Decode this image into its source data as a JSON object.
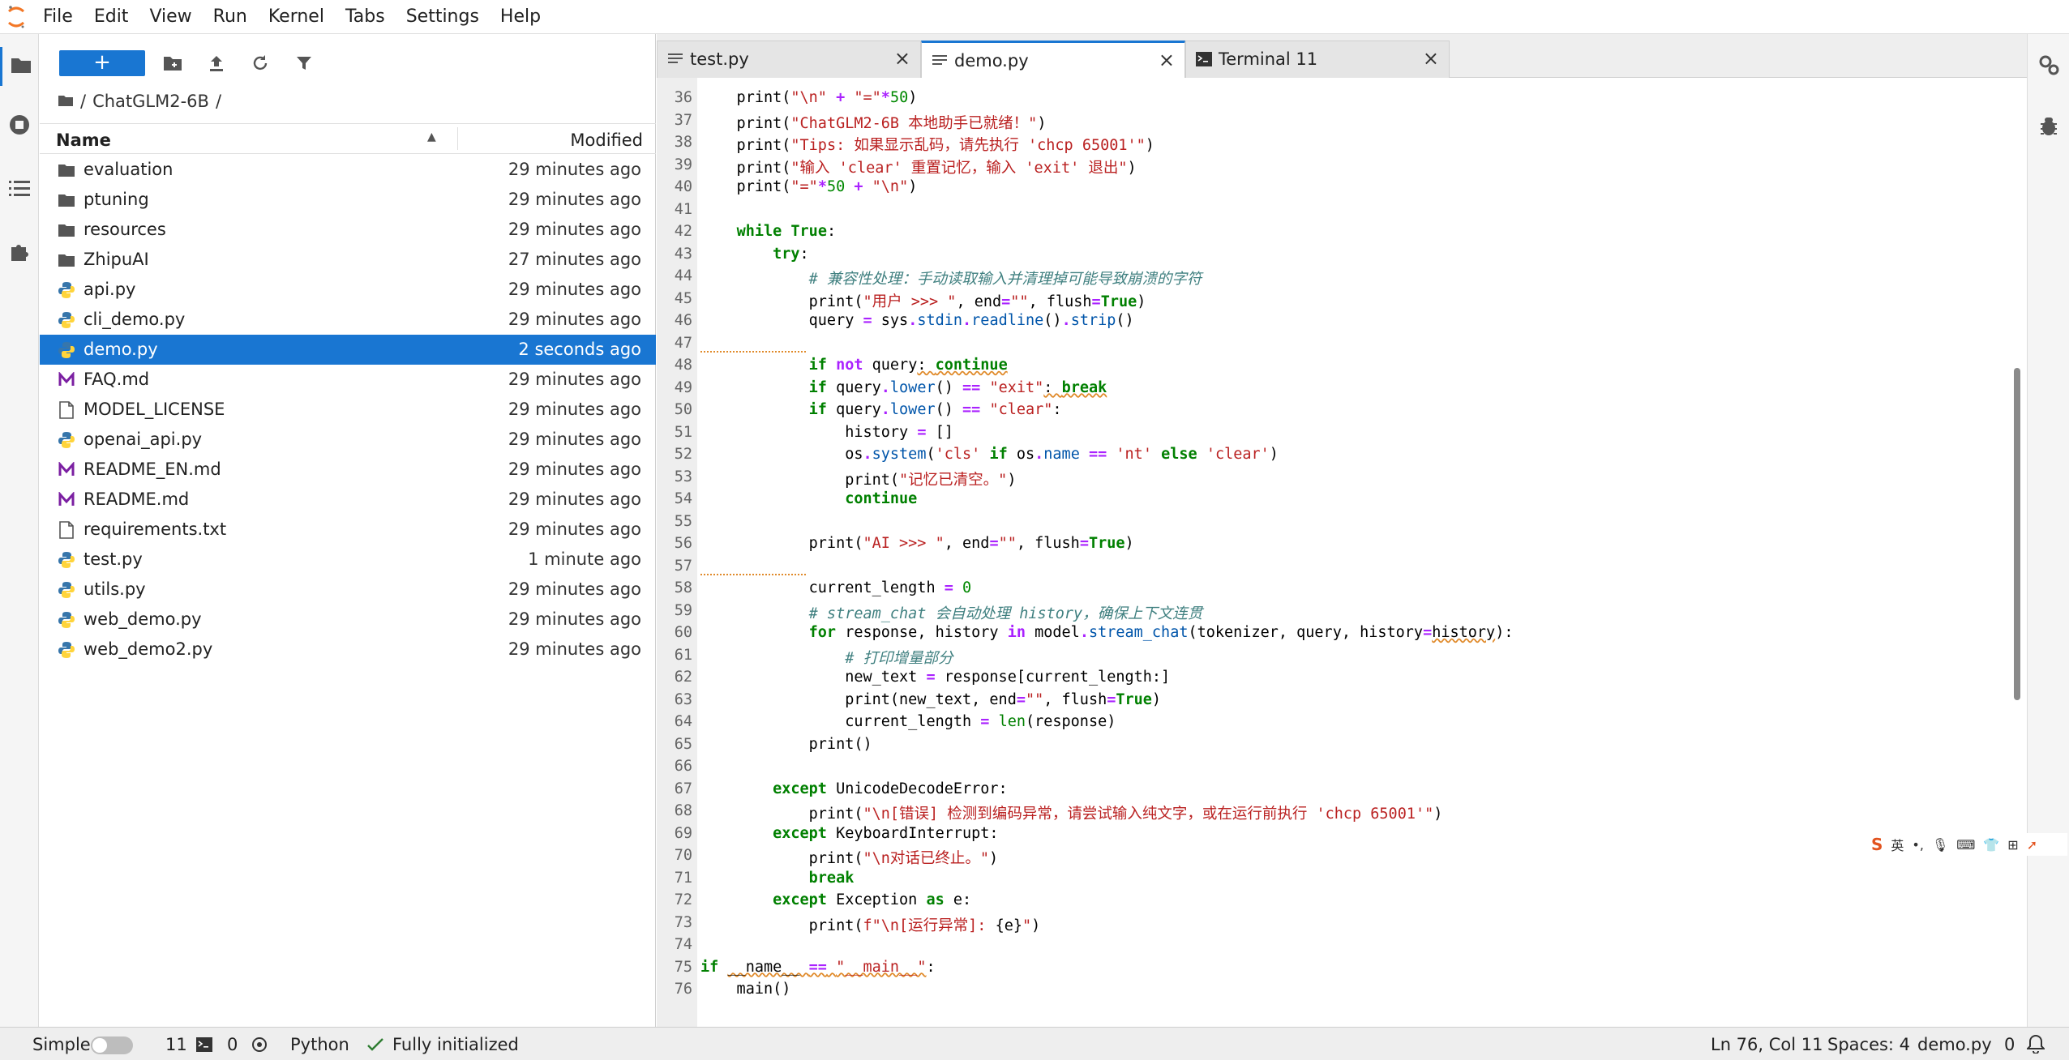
{
  "menubar": {
    "items": [
      "File",
      "Edit",
      "View",
      "Run",
      "Kernel",
      "Tabs",
      "Settings",
      "Help"
    ]
  },
  "filebrowser": {
    "new_label": "+",
    "breadcrumb": [
      "/",
      "ChatGLM2-6B",
      "/"
    ],
    "col_name": "Name",
    "col_modified": "Modified",
    "files": [
      {
        "name": "evaluation",
        "modified": "29 minutes ago",
        "icon": "folder-icon"
      },
      {
        "name": "ptuning",
        "modified": "29 minutes ago",
        "icon": "folder-icon"
      },
      {
        "name": "resources",
        "modified": "29 minutes ago",
        "icon": "folder-icon"
      },
      {
        "name": "ZhipuAI",
        "modified": "27 minutes ago",
        "icon": "folder-icon"
      },
      {
        "name": "api.py",
        "modified": "29 minutes ago",
        "icon": "python-file-icon"
      },
      {
        "name": "cli_demo.py",
        "modified": "29 minutes ago",
        "icon": "python-file-icon"
      },
      {
        "name": "demo.py",
        "modified": "2 seconds ago",
        "icon": "python-file-icon",
        "selected": true
      },
      {
        "name": "FAQ.md",
        "modified": "29 minutes ago",
        "icon": "markdown-file-icon"
      },
      {
        "name": "MODEL_LICENSE",
        "modified": "29 minutes ago",
        "icon": "text-file-icon"
      },
      {
        "name": "openai_api.py",
        "modified": "29 minutes ago",
        "icon": "python-file-icon"
      },
      {
        "name": "README_EN.md",
        "modified": "29 minutes ago",
        "icon": "markdown-file-icon"
      },
      {
        "name": "README.md",
        "modified": "29 minutes ago",
        "icon": "markdown-file-icon"
      },
      {
        "name": "requirements.txt",
        "modified": "29 minutes ago",
        "icon": "text-file-icon"
      },
      {
        "name": "test.py",
        "modified": "1 minute ago",
        "icon": "python-file-icon"
      },
      {
        "name": "utils.py",
        "modified": "29 minutes ago",
        "icon": "python-file-icon"
      },
      {
        "name": "web_demo.py",
        "modified": "29 minutes ago",
        "icon": "python-file-icon"
      },
      {
        "name": "web_demo2.py",
        "modified": "29 minutes ago",
        "icon": "python-file-icon"
      }
    ]
  },
  "tabs": [
    {
      "label": "test.py",
      "icon": "text-editor-icon",
      "active": false,
      "close": "×"
    },
    {
      "label": "demo.py",
      "icon": "text-editor-icon",
      "active": true,
      "close": "×"
    },
    {
      "label": "Terminal 11",
      "icon": "terminal-icon",
      "active": false,
      "close": "×"
    }
  ],
  "add_tab": "+",
  "editor": {
    "lines": [
      {
        "n": "36",
        "html": "    print(<span class='str'>\"\\n\"</span> <span class='op'>+</span> <span class='str'>\"=\"</span><span class='op'>*</span><span class='num'>50</span>)"
      },
      {
        "n": "37",
        "html": "    print(<span class='str'>\"ChatGLM2-6B 本地助手已就绪！\"</span>)"
      },
      {
        "n": "38",
        "html": "    print(<span class='str'>\"Tips: 如果显示乱码，请先执行 'chcp 65001'\"</span>)"
      },
      {
        "n": "39",
        "html": "    print(<span class='str'>\"输入 'clear' 重置记忆，输入 'exit' 退出\"</span>)"
      },
      {
        "n": "40",
        "html": "    print(<span class='str'>\"=\"</span><span class='op'>*</span><span class='num'>50</span> <span class='op'>+</span> <span class='str'>\"\\n\"</span>)"
      },
      {
        "n": "41",
        "html": ""
      },
      {
        "n": "42",
        "html": "    <span class='kw'>while</span> <span class='kw'>True</span>:"
      },
      {
        "n": "43",
        "html": "        <span class='kw'>try</span>:"
      },
      {
        "n": "44",
        "html": "            <span class='cm'># 兼容性处理：手动读取输入并清理掉可能导致崩溃的字符</span>"
      },
      {
        "n": "45",
        "html": "            print(<span class='str'>\"用户 >>> \"</span>, end<span class='op'>=</span><span class='str'>\"\"</span>, flush<span class='op'>=</span><span class='kw'>True</span>)"
      },
      {
        "n": "46",
        "html": "            query <span class='op'>=</span> sys<span class='op'>.</span><span class='attr'>stdin</span><span class='op'>.</span><span class='attr'>readline</span>()<span class='op'>.</span><span class='attr'>strip</span>()"
      },
      {
        "n": "47",
        "html": "",
        "squiggle": true
      },
      {
        "n": "48",
        "html": "            <span class='kw'>if</span> <span class='op'>not</span> query<span class='squiggle'>: <span class='kw'>continue</span></span>"
      },
      {
        "n": "49",
        "html": "            <span class='kw'>if</span> query<span class='op'>.</span><span class='attr'>lower</span>() <span class='op'>==</span> <span class='str'>\"exit\"</span><span class='squiggle'>: <span class='kw'>break</span></span>"
      },
      {
        "n": "50",
        "html": "            <span class='kw'>if</span> query<span class='op'>.</span><span class='attr'>lower</span>() <span class='op'>==</span> <span class='str'>\"clear\"</span>:"
      },
      {
        "n": "51",
        "html": "                history <span class='op'>=</span> []"
      },
      {
        "n": "52",
        "html": "                os<span class='op'>.</span><span class='attr'>system</span>(<span class='str'>'cls'</span> <span class='kw'>if</span> os<span class='op'>.</span><span class='attr'>name</span> <span class='op'>==</span> <span class='str'>'nt'</span> <span class='kw'>else</span> <span class='str'>'clear'</span>)"
      },
      {
        "n": "53",
        "html": "                print(<span class='str'>\"记忆已清空。\"</span>)"
      },
      {
        "n": "54",
        "html": "                <span class='kw'>continue</span>"
      },
      {
        "n": "55",
        "html": ""
      },
      {
        "n": "56",
        "html": "            print(<span class='str'>\"AI >>> \"</span>, end<span class='op'>=</span><span class='str'>\"\"</span>, flush<span class='op'>=</span><span class='kw'>True</span>)"
      },
      {
        "n": "57",
        "html": "",
        "squiggle": true
      },
      {
        "n": "58",
        "html": "            current_length <span class='op'>=</span> <span class='num'>0</span>"
      },
      {
        "n": "59",
        "html": "            <span class='cm'># stream_chat 会自动处理 history，确保上下文连贯</span>"
      },
      {
        "n": "60",
        "html": "            <span class='kw'>for</span> response, history <span class='op'>in</span> model<span class='op'>.</span><span class='attr'>stream_chat</span>(tokenizer, query, history<span class='op'>=</span><span class='squiggle'>history</span>):"
      },
      {
        "n": "61",
        "html": "                <span class='cm'># 打印增量部分</span>"
      },
      {
        "n": "62",
        "html": "                new_text <span class='op'>=</span> response[current_length:]"
      },
      {
        "n": "63",
        "html": "                print(new_text, end<span class='op'>=</span><span class='str'>\"\"</span>, flush<span class='op'>=</span><span class='kw'>True</span>)"
      },
      {
        "n": "64",
        "html": "                current_length <span class='op'>=</span> <span class='bi'>len</span>(response)"
      },
      {
        "n": "65",
        "html": "            print()"
      },
      {
        "n": "66",
        "html": ""
      },
      {
        "n": "67",
        "html": "        <span class='kw'>except</span> UnicodeDecodeError:"
      },
      {
        "n": "68",
        "html": "            print(<span class='str'>\"\\n[错误] 检测到编码异常，请尝试输入纯文字，或在运行前执行 'chcp 65001'\"</span>)"
      },
      {
        "n": "69",
        "html": "        <span class='kw'>except</span> KeyboardInterrupt:"
      },
      {
        "n": "70",
        "html": "            print(<span class='str'>\"\\n对话已终止。\"</span>)"
      },
      {
        "n": "71",
        "html": "            <span class='kw'>break</span>"
      },
      {
        "n": "72",
        "html": "        <span class='kw'>except</span> Exception <span class='kw'>as</span> e:"
      },
      {
        "n": "73",
        "html": "            print(<span class='str'>f\"\\n[运行异常]: </span>{e}<span class='str'>\"</span>)"
      },
      {
        "n": "74",
        "html": ""
      },
      {
        "n": "75",
        "html": "<span class='kw'>if</span> <span class='squiggle'>__name__ <span class='op'>==</span> <span class='str'>\"__main__\"</span></span>:"
      },
      {
        "n": "76",
        "html": "    main()"
      }
    ]
  },
  "ime": {
    "lang": "英",
    "icons": [
      "dot-icon",
      "mic-icon",
      "keyboard-icon",
      "shirt-icon",
      "grid-icon",
      "arrow-icon"
    ]
  },
  "statusbar": {
    "mode": "Simple",
    "terminals_count": "11",
    "kernels_count": "0",
    "language": "Python",
    "status": "Fully initialized",
    "cursor": "Ln 76, Col 11",
    "spaces": "Spaces: 4",
    "filename": "demo.py",
    "notifications": "0"
  },
  "colors": {
    "accent": "#1976d2"
  }
}
